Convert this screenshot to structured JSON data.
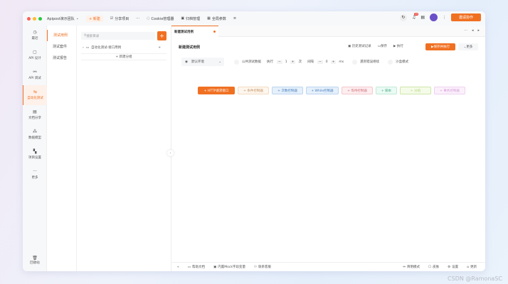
{
  "titlebar": {
    "team": "Apipost演示团队",
    "new": "+ 新建",
    "share": "分享项目",
    "more": "···",
    "cookie": "Cookie管理器",
    "archive": "归档管理",
    "globals": "全局参数",
    "notif_count": "39",
    "invite": "邀请协作"
  },
  "nav": [
    {
      "icon": "clock-icon",
      "glyph": "◷",
      "label": "最近"
    },
    {
      "icon": "api-design-icon",
      "glyph": "▢",
      "label": "API 设计"
    },
    {
      "icon": "api-debug-icon",
      "glyph": "⚯",
      "label": "API 调试"
    },
    {
      "icon": "automation-icon",
      "glyph": "⇆",
      "label": "自动化测试"
    },
    {
      "icon": "doc-share-icon",
      "glyph": "▤",
      "label": "文档分享"
    },
    {
      "icon": "data-model-icon",
      "glyph": "⁂",
      "label": "数据模型"
    },
    {
      "icon": "project-settings-icon",
      "glyph": "▚",
      "label": "项目设置"
    },
    {
      "icon": "more-icon",
      "glyph": "···",
      "label": "更多"
    }
  ],
  "trash": "回收站",
  "sub_nav": [
    "测试用例",
    "测试套件",
    "测试报告"
  ],
  "tree": {
    "search_placeholder": "搜索目录",
    "folder": "自动化测试-接口用例",
    "new_group": "+ 新建分组"
  },
  "tab": {
    "title": "新建测试用例"
  },
  "case": {
    "name": "新建测试用例",
    "history": "历史测试记录",
    "save": "保存",
    "run": "执行",
    "save_run": "保存并执行",
    "more": "更多"
  },
  "options": {
    "env": "默认环境",
    "public_data": "公共测试数据",
    "exec_label": "执行",
    "exec_count": "1",
    "exec_unit": "次",
    "interval_label": "间隔",
    "interval": "0",
    "interval_unit": "ms",
    "continue_on_error": "遇到错误继续",
    "sandbox": "沙盒模式"
  },
  "add_buttons": [
    {
      "label": "+ HTTP请求接口",
      "bg": "#f07022",
      "fg": "#ffffff",
      "border": "#f07022"
    },
    {
      "label": "+ 条件控制器",
      "bg": "#fdf6ee",
      "fg": "#c49060",
      "border": "#f3dcc3"
    },
    {
      "label": "+ 次数控制器",
      "bg": "#e5f0fb",
      "fg": "#4a7fbf",
      "border": "#bcd5f0"
    },
    {
      "label": "+ While控制器",
      "bg": "#e5f0fb",
      "fg": "#4a7fbf",
      "border": "#bcd5f0"
    },
    {
      "label": "+ 等待控制器",
      "bg": "#fdeef0",
      "fg": "#d0707a",
      "border": "#f3c8cd"
    },
    {
      "label": "+ 脚本",
      "bg": "#eafaf4",
      "fg": "#4fae88",
      "border": "#c3ead9"
    },
    {
      "label": "+ 分组",
      "bg": "#f5fbe9",
      "fg": "#b6d67c",
      "border": "#cfe6a9"
    },
    {
      "label": "+ 事务控制器",
      "bg": "#fbf1fb",
      "fg": "#d49ad8",
      "border": "#eed2f0"
    }
  ],
  "footer": {
    "help": "帮助文档",
    "mock": "内置Mock字段变量",
    "support": "联系客服",
    "simple": "简明模式",
    "skin": "皮肤",
    "settings": "设置",
    "update": "更新"
  },
  "watermark": "CSDN @RamonaSC"
}
